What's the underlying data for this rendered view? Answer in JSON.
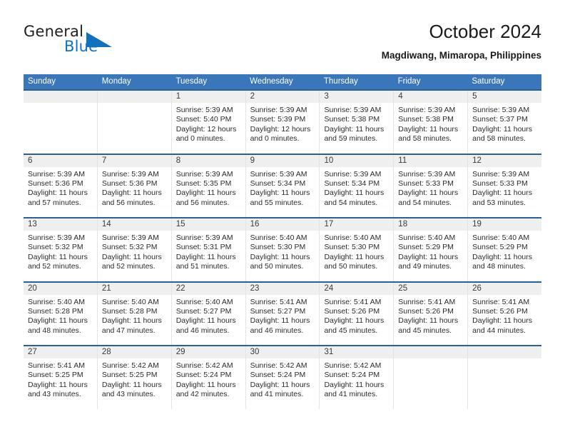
{
  "brand": {
    "name_part1": "General",
    "name_part2": "Blue",
    "triangle_color": "#1271bf"
  },
  "header": {
    "title": "October 2024",
    "subtitle": "Magdiwang, Mimaropa, Philippines"
  },
  "colors": {
    "header_blue": "#3a76ba",
    "row_divider_blue": "#2a5f9e",
    "daynum_band": "#efefef",
    "brand_blue": "#1271bf"
  },
  "weekdays": [
    "Sunday",
    "Monday",
    "Tuesday",
    "Wednesday",
    "Thursday",
    "Friday",
    "Saturday"
  ],
  "weeks": [
    [
      {
        "day": "",
        "sunrise": "",
        "sunset": "",
        "daylight": "",
        "empty": true
      },
      {
        "day": "",
        "sunrise": "",
        "sunset": "",
        "daylight": "",
        "empty": true
      },
      {
        "day": "1",
        "sunrise": "Sunrise: 5:39 AM",
        "sunset": "Sunset: 5:40 PM",
        "daylight": "Daylight: 12 hours and 0 minutes."
      },
      {
        "day": "2",
        "sunrise": "Sunrise: 5:39 AM",
        "sunset": "Sunset: 5:39 PM",
        "daylight": "Daylight: 12 hours and 0 minutes."
      },
      {
        "day": "3",
        "sunrise": "Sunrise: 5:39 AM",
        "sunset": "Sunset: 5:38 PM",
        "daylight": "Daylight: 11 hours and 59 minutes."
      },
      {
        "day": "4",
        "sunrise": "Sunrise: 5:39 AM",
        "sunset": "Sunset: 5:38 PM",
        "daylight": "Daylight: 11 hours and 58 minutes."
      },
      {
        "day": "5",
        "sunrise": "Sunrise: 5:39 AM",
        "sunset": "Sunset: 5:37 PM",
        "daylight": "Daylight: 11 hours and 58 minutes."
      }
    ],
    [
      {
        "day": "6",
        "sunrise": "Sunrise: 5:39 AM",
        "sunset": "Sunset: 5:36 PM",
        "daylight": "Daylight: 11 hours and 57 minutes."
      },
      {
        "day": "7",
        "sunrise": "Sunrise: 5:39 AM",
        "sunset": "Sunset: 5:36 PM",
        "daylight": "Daylight: 11 hours and 56 minutes."
      },
      {
        "day": "8",
        "sunrise": "Sunrise: 5:39 AM",
        "sunset": "Sunset: 5:35 PM",
        "daylight": "Daylight: 11 hours and 56 minutes."
      },
      {
        "day": "9",
        "sunrise": "Sunrise: 5:39 AM",
        "sunset": "Sunset: 5:34 PM",
        "daylight": "Daylight: 11 hours and 55 minutes."
      },
      {
        "day": "10",
        "sunrise": "Sunrise: 5:39 AM",
        "sunset": "Sunset: 5:34 PM",
        "daylight": "Daylight: 11 hours and 54 minutes."
      },
      {
        "day": "11",
        "sunrise": "Sunrise: 5:39 AM",
        "sunset": "Sunset: 5:33 PM",
        "daylight": "Daylight: 11 hours and 54 minutes."
      },
      {
        "day": "12",
        "sunrise": "Sunrise: 5:39 AM",
        "sunset": "Sunset: 5:33 PM",
        "daylight": "Daylight: 11 hours and 53 minutes."
      }
    ],
    [
      {
        "day": "13",
        "sunrise": "Sunrise: 5:39 AM",
        "sunset": "Sunset: 5:32 PM",
        "daylight": "Daylight: 11 hours and 52 minutes."
      },
      {
        "day": "14",
        "sunrise": "Sunrise: 5:39 AM",
        "sunset": "Sunset: 5:32 PM",
        "daylight": "Daylight: 11 hours and 52 minutes."
      },
      {
        "day": "15",
        "sunrise": "Sunrise: 5:39 AM",
        "sunset": "Sunset: 5:31 PM",
        "daylight": "Daylight: 11 hours and 51 minutes."
      },
      {
        "day": "16",
        "sunrise": "Sunrise: 5:40 AM",
        "sunset": "Sunset: 5:30 PM",
        "daylight": "Daylight: 11 hours and 50 minutes."
      },
      {
        "day": "17",
        "sunrise": "Sunrise: 5:40 AM",
        "sunset": "Sunset: 5:30 PM",
        "daylight": "Daylight: 11 hours and 50 minutes."
      },
      {
        "day": "18",
        "sunrise": "Sunrise: 5:40 AM",
        "sunset": "Sunset: 5:29 PM",
        "daylight": "Daylight: 11 hours and 49 minutes."
      },
      {
        "day": "19",
        "sunrise": "Sunrise: 5:40 AM",
        "sunset": "Sunset: 5:29 PM",
        "daylight": "Daylight: 11 hours and 48 minutes."
      }
    ],
    [
      {
        "day": "20",
        "sunrise": "Sunrise: 5:40 AM",
        "sunset": "Sunset: 5:28 PM",
        "daylight": "Daylight: 11 hours and 48 minutes."
      },
      {
        "day": "21",
        "sunrise": "Sunrise: 5:40 AM",
        "sunset": "Sunset: 5:28 PM",
        "daylight": "Daylight: 11 hours and 47 minutes."
      },
      {
        "day": "22",
        "sunrise": "Sunrise: 5:40 AM",
        "sunset": "Sunset: 5:27 PM",
        "daylight": "Daylight: 11 hours and 46 minutes."
      },
      {
        "day": "23",
        "sunrise": "Sunrise: 5:41 AM",
        "sunset": "Sunset: 5:27 PM",
        "daylight": "Daylight: 11 hours and 46 minutes."
      },
      {
        "day": "24",
        "sunrise": "Sunrise: 5:41 AM",
        "sunset": "Sunset: 5:26 PM",
        "daylight": "Daylight: 11 hours and 45 minutes."
      },
      {
        "day": "25",
        "sunrise": "Sunrise: 5:41 AM",
        "sunset": "Sunset: 5:26 PM",
        "daylight": "Daylight: 11 hours and 45 minutes."
      },
      {
        "day": "26",
        "sunrise": "Sunrise: 5:41 AM",
        "sunset": "Sunset: 5:26 PM",
        "daylight": "Daylight: 11 hours and 44 minutes."
      }
    ],
    [
      {
        "day": "27",
        "sunrise": "Sunrise: 5:41 AM",
        "sunset": "Sunset: 5:25 PM",
        "daylight": "Daylight: 11 hours and 43 minutes."
      },
      {
        "day": "28",
        "sunrise": "Sunrise: 5:42 AM",
        "sunset": "Sunset: 5:25 PM",
        "daylight": "Daylight: 11 hours and 43 minutes."
      },
      {
        "day": "29",
        "sunrise": "Sunrise: 5:42 AM",
        "sunset": "Sunset: 5:24 PM",
        "daylight": "Daylight: 11 hours and 42 minutes."
      },
      {
        "day": "30",
        "sunrise": "Sunrise: 5:42 AM",
        "sunset": "Sunset: 5:24 PM",
        "daylight": "Daylight: 11 hours and 41 minutes."
      },
      {
        "day": "31",
        "sunrise": "Sunrise: 5:42 AM",
        "sunset": "Sunset: 5:24 PM",
        "daylight": "Daylight: 11 hours and 41 minutes."
      },
      {
        "day": "",
        "sunrise": "",
        "sunset": "",
        "daylight": "",
        "empty": true
      },
      {
        "day": "",
        "sunrise": "",
        "sunset": "",
        "daylight": "",
        "empty": true
      }
    ]
  ]
}
